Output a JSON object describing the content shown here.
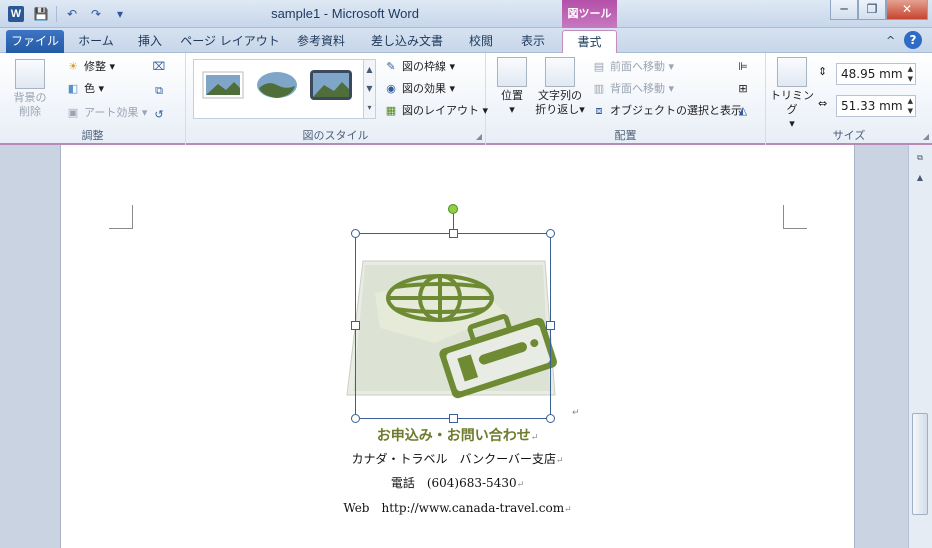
{
  "window": {
    "title": "sample1 - Microsoft Word",
    "app_icon": "W",
    "contextual_header": "図ツール",
    "minimize": "─",
    "restore": "❐",
    "close": "✕"
  },
  "qat": {
    "save_icon": "💾",
    "undo_icon": "↶",
    "redo_icon": "↷",
    "customize_icon": "▾"
  },
  "tabs": [
    {
      "label": "ファイル"
    },
    {
      "label": "ホーム"
    },
    {
      "label": "挿入"
    },
    {
      "label": "ページ レイアウト"
    },
    {
      "label": "参考資料"
    },
    {
      "label": "差し込み文書"
    },
    {
      "label": "校閲"
    },
    {
      "label": "表示"
    },
    {
      "label": "書式"
    }
  ],
  "ribbon_ctl": {
    "collapse": "^",
    "help": "?"
  },
  "ribbon": {
    "adjust": {
      "label": "調整",
      "remove_bg": "背景の\n削除",
      "corrections": "修整 ▾",
      "color": "色 ▾",
      "artistic": "アート効果 ▾"
    },
    "styles": {
      "label": "図のスタイル",
      "border": "図の枠線 ▾",
      "effects": "図の効果 ▾",
      "layout": "図のレイアウト ▾"
    },
    "arrange": {
      "label": "配置",
      "position": "位置",
      "wrap_text_1": "文字列の",
      "wrap_text_2": "折り返し▾",
      "bring_forward": "前面へ移動 ▾",
      "send_backward": "背面へ移動 ▾",
      "selection_pane": "オブジェクトの選択と表示"
    },
    "size": {
      "label": "サイズ",
      "crop": "トリミング",
      "height": "48.95 mm",
      "width": "51.33 mm"
    }
  },
  "document": {
    "heading": "お申込み・お問い合わせ",
    "line1": "カナダ・トラベル　バンクーバー支店",
    "line2": "電話　(604)683-5430",
    "line3": "Web　http://www.canada-travel.com",
    "para_mark": "↵"
  },
  "colors": {
    "accent_tab": "#b44fa9",
    "heading": "#6c7b2c",
    "file_tab": "#2b5aa5"
  }
}
